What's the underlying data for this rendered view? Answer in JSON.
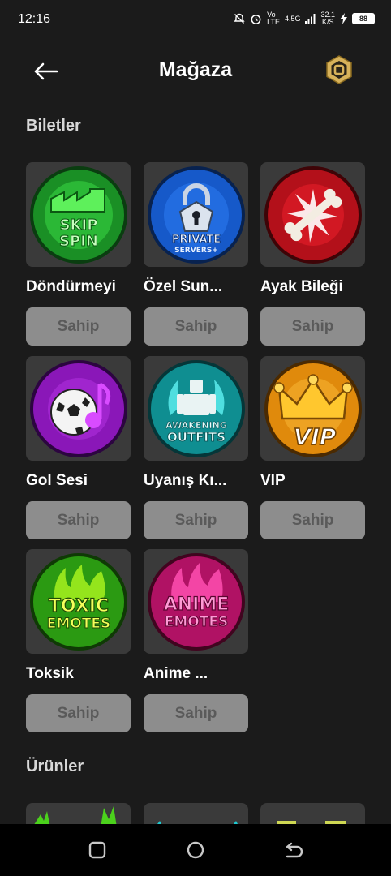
{
  "status": {
    "time": "12:16",
    "network_top": "Vo",
    "network_bottom": "LTE",
    "signal_label": "4.5G",
    "speed_value": "32.1",
    "speed_unit": "K/S",
    "battery": "88"
  },
  "header": {
    "title": "Mağaza",
    "back_icon": "arrow-left-icon",
    "currency_icon": "robux-icon"
  },
  "sections": {
    "tickets_title": "Biletler",
    "products_title": "Ürünler"
  },
  "items": [
    {
      "name": "Döndürmeyi",
      "button": "Sahip",
      "art_text": [
        "SKIP",
        "SPIN"
      ],
      "icon": "skip-spin-icon",
      "color": "#2fd13a"
    },
    {
      "name": "Özel Sun...",
      "button": "Sahip",
      "art_text": [
        "PRIVATE",
        "SERVERS+"
      ],
      "icon": "private-servers-icon",
      "color": "#1f6fe0"
    },
    {
      "name": "Ayak Bileği",
      "button": "Sahip",
      "art_text": [],
      "icon": "broken-bone-icon",
      "color": "#d4141c"
    },
    {
      "name": "Gol Sesi",
      "button": "Sahip",
      "art_text": [],
      "icon": "goal-sound-icon",
      "color": "#a31fd1"
    },
    {
      "name": "Uyanış Kı...",
      "button": "Sahip",
      "art_text": [
        "AWAKENING",
        "OUTFITS"
      ],
      "icon": "awakening-outfits-icon",
      "color": "#19c9c9"
    },
    {
      "name": "VIP",
      "button": "Sahip",
      "art_text": [
        "VIP"
      ],
      "icon": "vip-crown-icon",
      "color": "#f2a216"
    },
    {
      "name": "Toksik",
      "button": "Sahip",
      "art_text": [
        "TOXIC",
        "EMOTES"
      ],
      "icon": "toxic-emotes-icon",
      "color": "#49d11c"
    },
    {
      "name": "Anime ...",
      "button": "Sahip",
      "art_text": [
        "ANIME",
        "EMOTES"
      ],
      "icon": "anime-emotes-icon",
      "color": "#e21b86"
    }
  ],
  "nav": {
    "recents_icon": "recents-square-icon",
    "home_icon": "home-circle-icon",
    "back_icon": "nav-back-icon"
  }
}
